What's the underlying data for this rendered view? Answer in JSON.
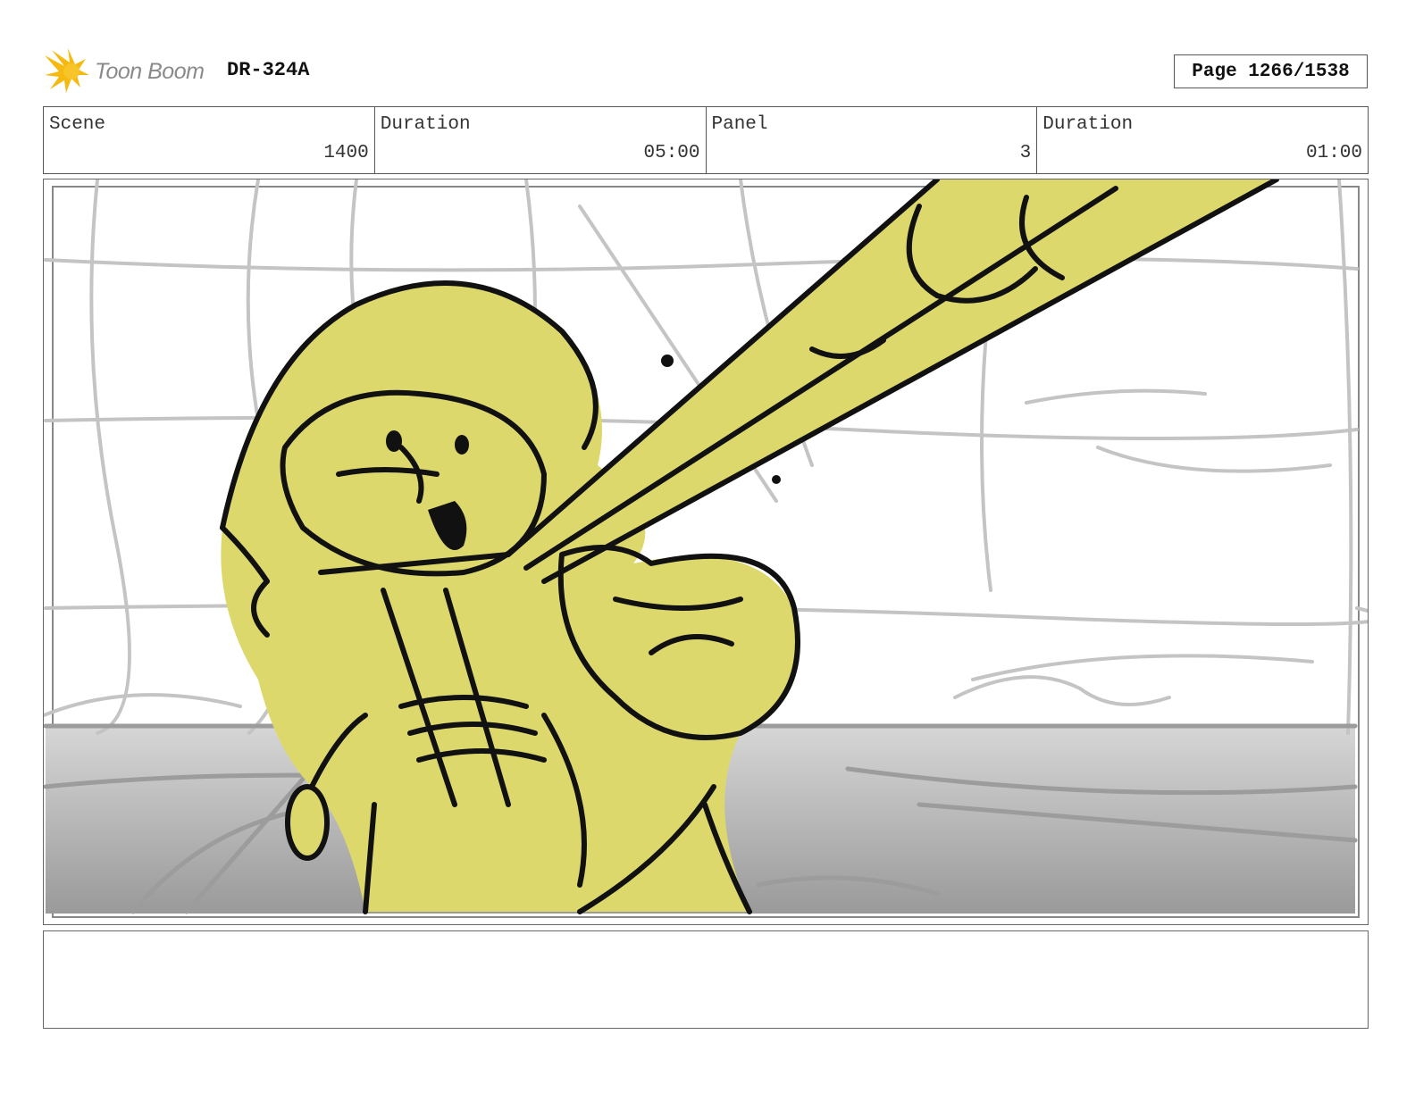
{
  "header": {
    "logo_text": "Toon Boom",
    "project_code": "DR-324A",
    "page_label": "Page 1266/1538"
  },
  "info": {
    "scene_label": "Scene",
    "scene_value": "1400",
    "scene_duration_label": "Duration",
    "scene_duration_value": "05:00",
    "panel_label": "Panel",
    "panel_value": "3",
    "panel_duration_label": "Duration",
    "panel_duration_value": "01:00"
  },
  "panel": {
    "icon": "storyboard-sketch",
    "colors": {
      "character_fill": "#ddd86c",
      "outline": "#111111",
      "background_line": "#c4c4c4"
    }
  },
  "notes": {
    "text": ""
  },
  "colors": {
    "logo_star": "#f5b90f",
    "border": "#555555"
  }
}
